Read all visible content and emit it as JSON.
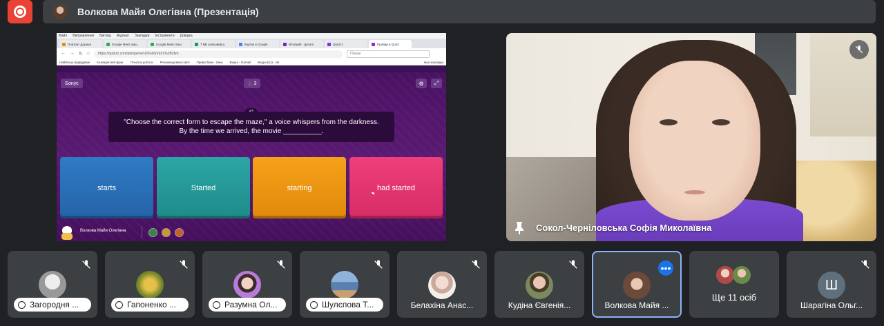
{
  "topbar": {
    "presenter_title": "Волкова Майя Олегівна (Презентація)"
  },
  "presentation": {
    "browser": {
      "menu": [
        "Файл",
        "Виправлення",
        "Вигляд",
        "Журнал",
        "Закладки",
        "Інструменти",
        "Довідка"
      ],
      "tabs": [
        {
          "label": "Портрет Дорана",
          "color": "#f28b00"
        },
        {
          "label": "Google Meet: ваш",
          "color": "#34a853"
        },
        {
          "label": "Google Meet: ваш",
          "color": "#34a853"
        },
        {
          "label": "7 ВВ заліковий д",
          "color": "#0f9d58"
        },
        {
          "label": "Картки в Google",
          "color": "#4285f4"
        },
        {
          "label": "Wordwall - Деталі",
          "color": "#6a2cbc"
        },
        {
          "label": "Quizizz",
          "color": "#8b2bd6"
        },
        {
          "label": "Пройди в Quizz",
          "color": "#8b2bd6"
        }
      ],
      "url": "https://quizizz.com/join/game/U2FsdGVkX1%2B2bm",
      "search_placeholder": "Пошук",
      "bookmarks": [
        "Найбільш відвідувані",
        "Колекція веб-фраг",
        "Початок роботи",
        "Рекомендовані сайті",
        "Приватбанк - банк",
        "Вхідні - hotmail",
        "Вхідні (61) - vik",
        "Інші закладки"
      ]
    },
    "quiz": {
      "bonus_label": "Бонус",
      "streak": "3",
      "counter": "4/5",
      "question_line1": "\"Choose the correct form to escape the maze,\" a voice whispers from the darkness.",
      "question_line2": "By the time we arrived, the movie __________.",
      "answers": [
        "starts",
        "Started",
        "starting",
        "had started"
      ],
      "player_name": "Волкова Майя Олегівна"
    }
  },
  "camera": {
    "name": "Сокол-Черніловська Софія Миколаївна"
  },
  "participants": [
    {
      "name": "Загородня ...",
      "style": "pill",
      "avatar_color": "#cfcfcf"
    },
    {
      "name": "Гапоненко ...",
      "style": "pill",
      "avatar_color": "#c8a028"
    },
    {
      "name": "Разумна Ол...",
      "style": "pill",
      "avatar_color": "#b77bd8"
    },
    {
      "name": "Шулєпова Т...",
      "style": "pill",
      "avatar_color": "#5a7fb0"
    },
    {
      "name": "Белахіна Анас...",
      "style": "plain",
      "avatar_color": "#e8d6cd"
    },
    {
      "name": "Кудіна Євгенія...",
      "style": "plain",
      "avatar_color": "#7a8a5c"
    },
    {
      "name": "Волкова Майя ...",
      "style": "plain",
      "avatar_color": "#6b4a3a"
    },
    {
      "name": "Ще 11 осіб",
      "style": "plain",
      "avatar_color": "#b04a4a"
    },
    {
      "name": "Шарагіна Ольг...",
      "style": "plain",
      "avatar_letter": "Ш"
    }
  ]
}
